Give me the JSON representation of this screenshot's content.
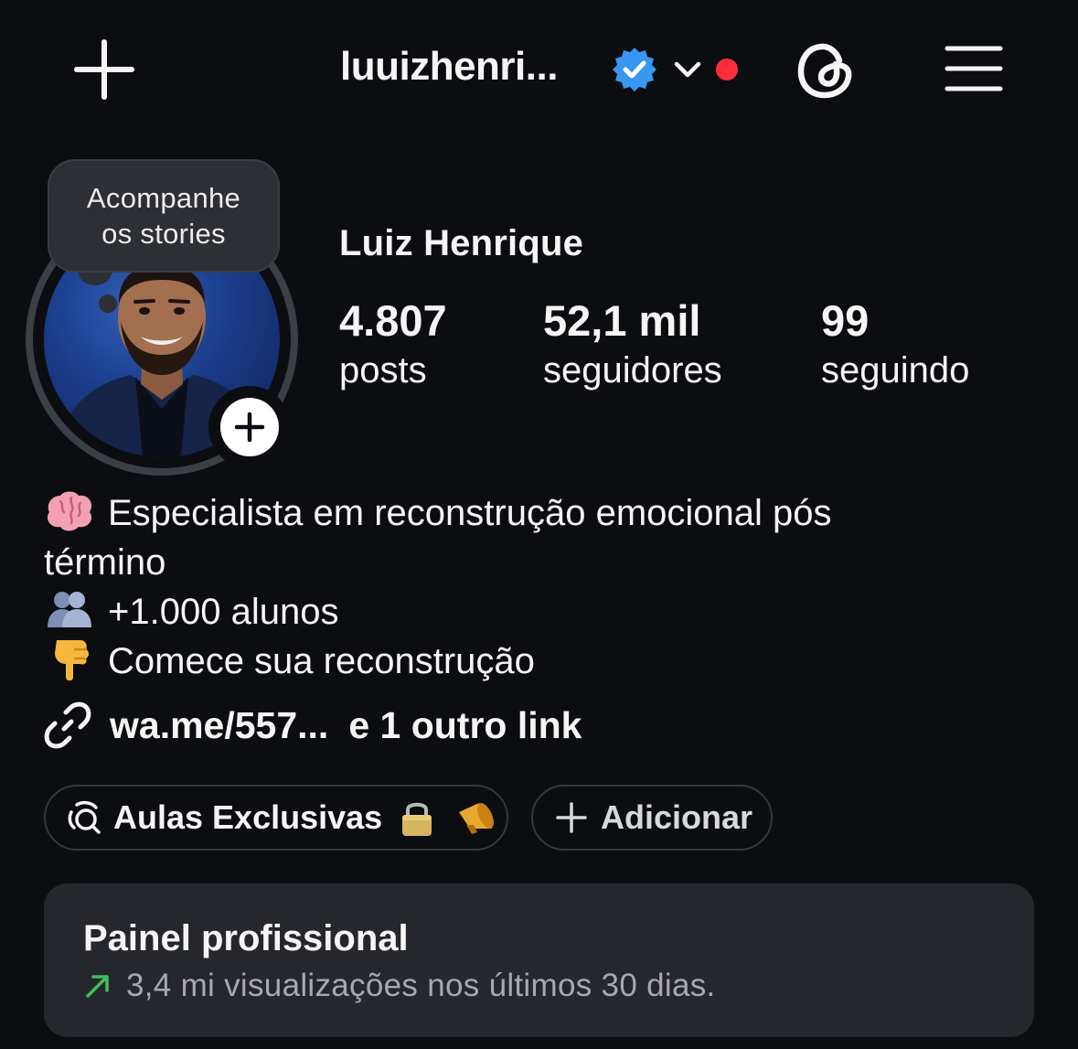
{
  "header": {
    "username": "luuizhenri...",
    "verified_color": "#3897f0",
    "notification_dot_color": "#ff2d3b"
  },
  "tooltip": {
    "line1": "Acompanhe",
    "line2": "os stories"
  },
  "profile": {
    "full_name": "Luiz Henrique",
    "stats": {
      "posts": {
        "value": "4.807",
        "label": "posts"
      },
      "followers": {
        "value": "52,1 mil",
        "label": "seguidores"
      },
      "following": {
        "value": "99",
        "label": "seguindo"
      }
    }
  },
  "bio": {
    "line1_icon": "brain-icon",
    "line1": "Especialista em reconstrução emocional pós",
    "line1b": "término",
    "line2_icon": "people-icon",
    "line2": "+1.000 alunos",
    "line3_icon": "pointing-down-icon",
    "line3": "Comece sua reconstrução"
  },
  "links": {
    "primary": "wa.me/557...",
    "more": "e 1 outro link"
  },
  "highlights": [
    {
      "label": "Aulas Exclusivas",
      "icons": [
        "lock-icon",
        "megaphone-icon"
      ]
    },
    {
      "label": "Adicionar",
      "icon": "plus-icon"
    }
  ],
  "professional_panel": {
    "title": "Painel profissional",
    "subtitle": "3,4 mi visualizações nos últimos 30 dias.",
    "trend_color": "#3fbf5b"
  }
}
